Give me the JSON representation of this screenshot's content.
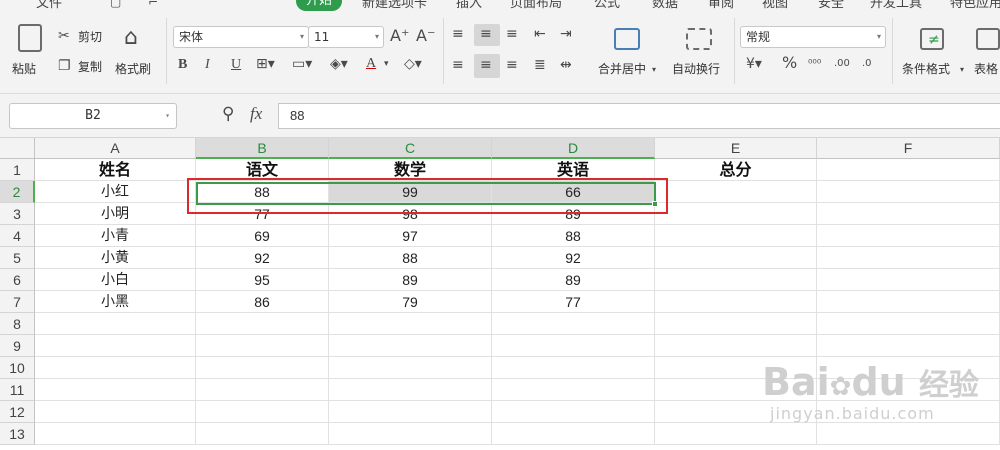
{
  "menu": {
    "items": [
      "文件",
      "开始",
      "新建选项卡",
      "插入",
      "页面布局",
      "公式",
      "数据",
      "审阅",
      "视图",
      "安全",
      "开发工具",
      "特色应用"
    ],
    "active_index": 1
  },
  "ribbon": {
    "paste_label": "粘贴",
    "cut_label": "剪切",
    "copy_label": "复制",
    "format_painter_label": "格式刷",
    "font_name": "宋体",
    "font_size": "11",
    "bold_label": "B",
    "italic_label": "I",
    "underline_label": "U",
    "font_color_label": "A",
    "merge_center_label": "合并居中",
    "wrap_text_label": "自动换行",
    "number_format": "常规",
    "percent_label": "%",
    "conditional_format_label": "条件格式",
    "table_style_label": "表格"
  },
  "formula_bar": {
    "name_box": "B2",
    "fx_label": "fx",
    "value": "88"
  },
  "sheet": {
    "columns": [
      "A",
      "B",
      "C",
      "D",
      "E",
      "F"
    ],
    "rows": [
      "1",
      "2",
      "3",
      "4",
      "5",
      "6",
      "7",
      "8",
      "9",
      "10",
      "11",
      "12",
      "13"
    ],
    "header_row": [
      "姓名",
      "语文",
      "数学",
      "英语",
      "总分"
    ],
    "data": [
      [
        "小红",
        "88",
        "99",
        "66"
      ],
      [
        "小明",
        "77",
        "98",
        "89"
      ],
      [
        "小青",
        "69",
        "97",
        "88"
      ],
      [
        "小黄",
        "92",
        "88",
        "92"
      ],
      [
        "小白",
        "95",
        "89",
        "89"
      ],
      [
        "小黑",
        "86",
        "79",
        "77"
      ]
    ],
    "selected_range": "B2:D2"
  },
  "watermark": {
    "brand": "Bai",
    "brand2": "du",
    "cn": "经验",
    "url": "jingyan.baidu.com"
  },
  "colors": {
    "accent_green": "#3c9a4a",
    "annotation_red": "#d92b2b"
  }
}
